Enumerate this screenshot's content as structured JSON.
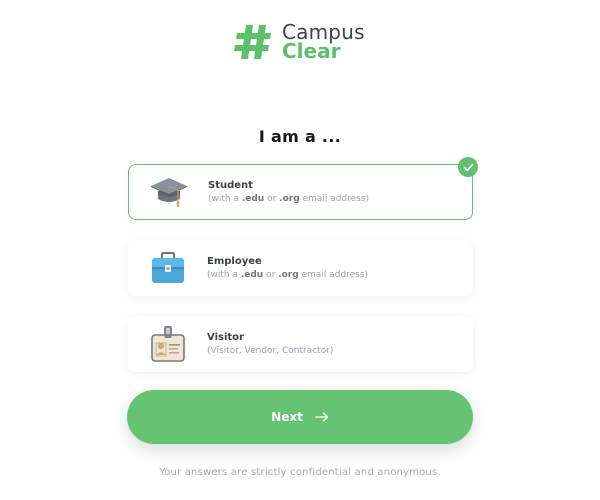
{
  "logo": {
    "word1": "Campus",
    "word2": "Clear",
    "mark_icon": "hash-logo-icon"
  },
  "heading": "I am a ...",
  "options": [
    {
      "icon": "graduation-cap-icon",
      "title": "Student",
      "sub_prefix": "(with a ",
      "sub_bold1": ".edu",
      "sub_mid": " or ",
      "sub_bold2": ".org",
      "sub_suffix": " email address)",
      "selected": true
    },
    {
      "icon": "briefcase-icon",
      "title": "Employee",
      "sub_prefix": "(with a ",
      "sub_bold1": ".edu",
      "sub_mid": " or ",
      "sub_bold2": ".org",
      "sub_suffix": " email address)",
      "selected": false
    },
    {
      "icon": "id-badge-icon",
      "title": "Visitor",
      "sub": "(Visitor, Vendor, Contractor)",
      "selected": false
    }
  ],
  "next_button": {
    "label": "Next",
    "icon": "arrow-right-icon"
  },
  "footer_note": "Your answers are strictly confidential and anonymous.",
  "colors": {
    "brand_green": "#62c070",
    "button_green": "#66c373",
    "text_dark": "#3b404b",
    "text_muted": "#9aa1ad"
  }
}
